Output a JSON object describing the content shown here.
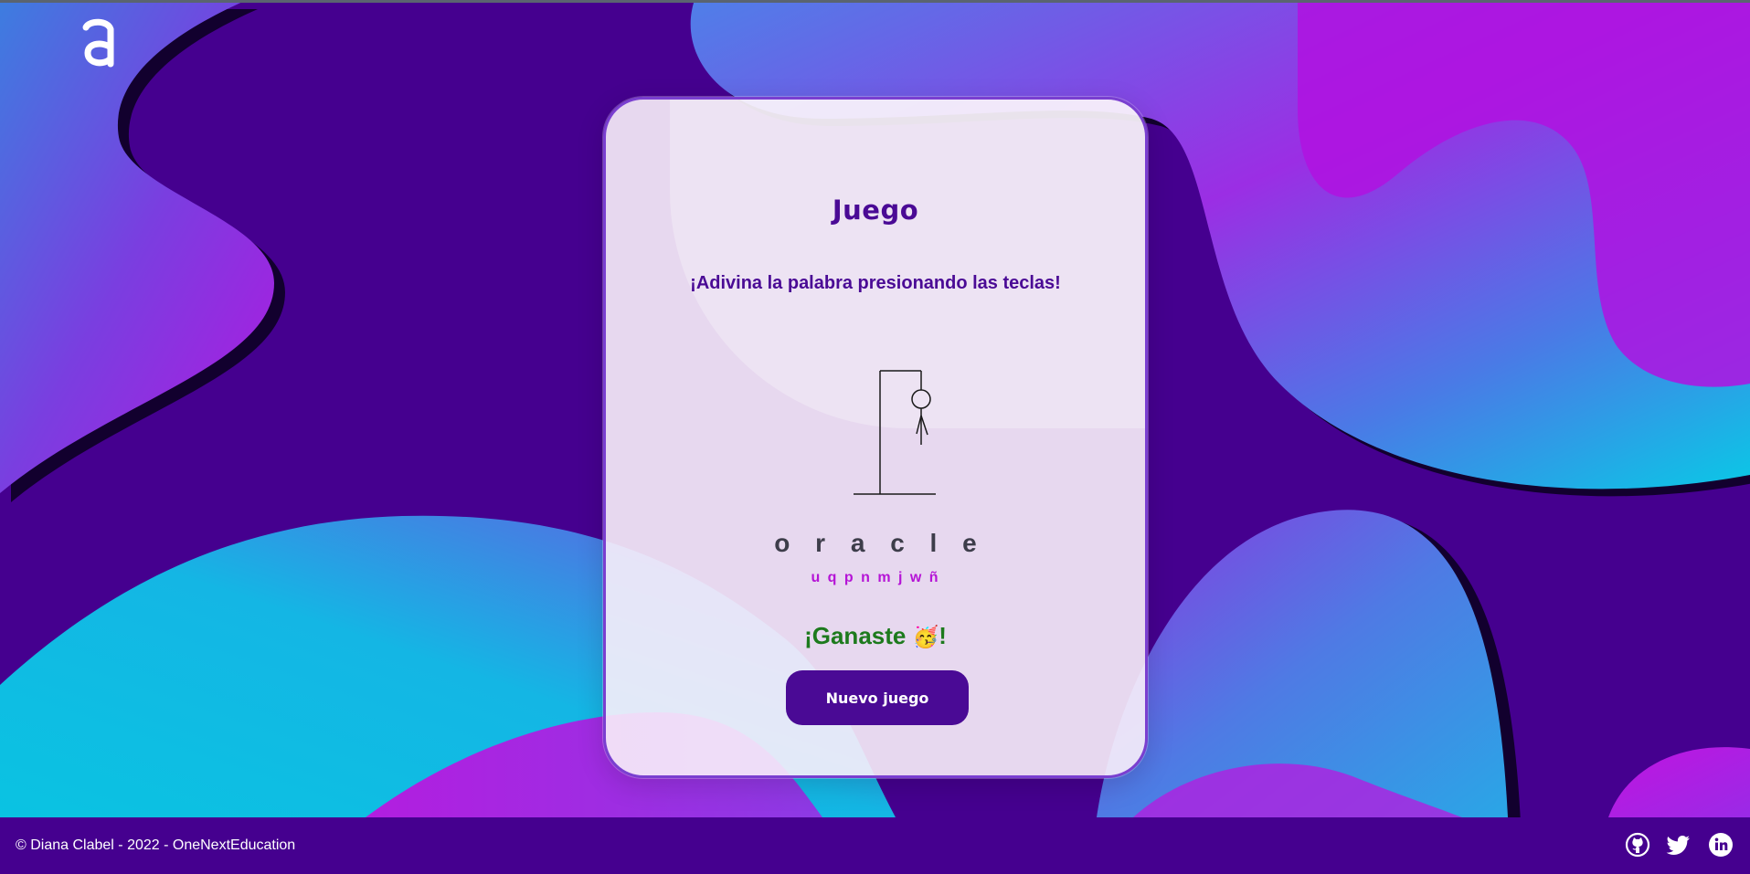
{
  "colors": {
    "deep_purple": "#45008f",
    "accent_purple": "#4a0a95",
    "magenta": "#b514d6",
    "cyan": "#0ac3e2",
    "win_green": "#1d7a1d"
  },
  "header": {
    "logo_icon": "alura-a-logo-icon"
  },
  "game": {
    "title": "Juego",
    "subtitle": "¡Adivina la palabra presionando las teclas!",
    "word": "oracle",
    "word_display": "o r a c l e",
    "wrong_letters": [
      "u",
      "q",
      "p",
      "n",
      "m",
      "j",
      "w",
      "ñ"
    ],
    "wrong_display": "u q p n m j w ñ",
    "mistakes": 8,
    "result_text": "¡Ganaste",
    "result_emoji": "🥳",
    "result_end": "!",
    "new_game_label": "Nuevo juego"
  },
  "footer": {
    "credit": "© Diana Clabel - 2022 - OneNextEducation",
    "social": [
      {
        "name": "github-icon"
      },
      {
        "name": "twitter-icon"
      },
      {
        "name": "linkedin-icon"
      }
    ]
  }
}
